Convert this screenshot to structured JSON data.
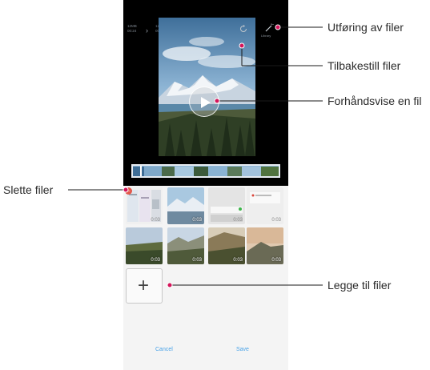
{
  "callouts": {
    "utforing": "Utføring av filer",
    "tilbakestill": "Tilbakestill filer",
    "forhandsvise": "Forhåndsvise en fil",
    "slette": "Slette filer",
    "legge_til": "Legge til filer"
  },
  "screen": {
    "info_left": [
      "12MB",
      "00:24"
    ],
    "info_right": [
      "12MB",
      "00:24"
    ],
    "magic_label": "Library",
    "thumb_durations": [
      "0:03",
      "0:03",
      "0:03",
      "0:03",
      "0:03",
      "0:03",
      "0:03",
      "0:03"
    ],
    "cancel_label": "Cancel",
    "save_label": "Save"
  },
  "colors": {
    "accent": "#4aa3e8",
    "delete_badge": "#e2584a",
    "callout_dot": "#d4145a"
  },
  "icons": {
    "reset": "reset-icon",
    "magic": "magic-wand-icon",
    "play": "play-icon",
    "add": "plus-icon",
    "delete": "minus-icon"
  }
}
